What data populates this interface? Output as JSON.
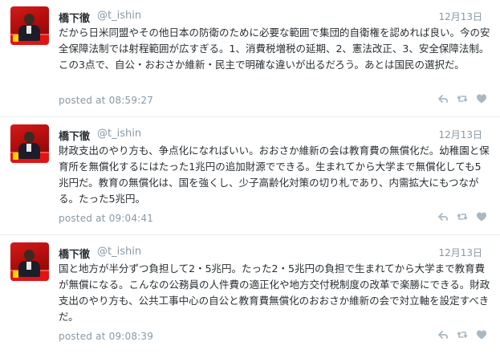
{
  "tweets": [
    {
      "name": "橋下徹",
      "handle": "@t_ishin",
      "date": "12月13日",
      "text": "だから日米同盟やその他日本の防衛のために必要な範囲で集団的自衛権を認めれば良い。今の安全保障法制では射程範囲が広すぎる。1、消費税増税の延期、2、憲法改正、3、安全保障法制。この3点で、自公・おおさか維新・民主で明確な違いが出るだろう。あとは国民の選択だ。",
      "posted": "posted at 08:59:27"
    },
    {
      "name": "橋下徹",
      "handle": "@t_ishin",
      "date": "12月13日",
      "text": "財政支出のやり方も、争点化になればいい。おおさか維新の会は教育費の無償化だ。幼稚園と保育所を無償化するにはたった1兆円の追加財源でできる。生まれてから大学まで無償化しても5兆円だ。教育の無償化は、国を強くし、少子高齢化対策の切り札であり、内需拡大にもつながる。たった5兆円。",
      "posted": "posted at 09:04:41"
    },
    {
      "name": "橋下徹",
      "handle": "@t_ishin",
      "date": "12月13日",
      "text": "国と地方が半分ずつ負担して2・5兆円。たった2・5兆円の負担で生まれてから大学まで教育費が無償になる。こんなの公務員の人件費の適正化や地方交付税制度の改革で楽勝にできる。財政支出のやり方も、公共工事中心の自公と教育費無償化のおおさか維新の会で対立軸を設定すべきだ。",
      "posted": "posted at 09:08:39"
    }
  ],
  "icons": {
    "reply": "reply-icon",
    "retweet": "retweet-icon",
    "like": "heart-icon"
  },
  "colors": {
    "text": "#292f33",
    "meta": "#8899a6",
    "icon": "#aab8c2",
    "divider": "#e6ecf0"
  }
}
